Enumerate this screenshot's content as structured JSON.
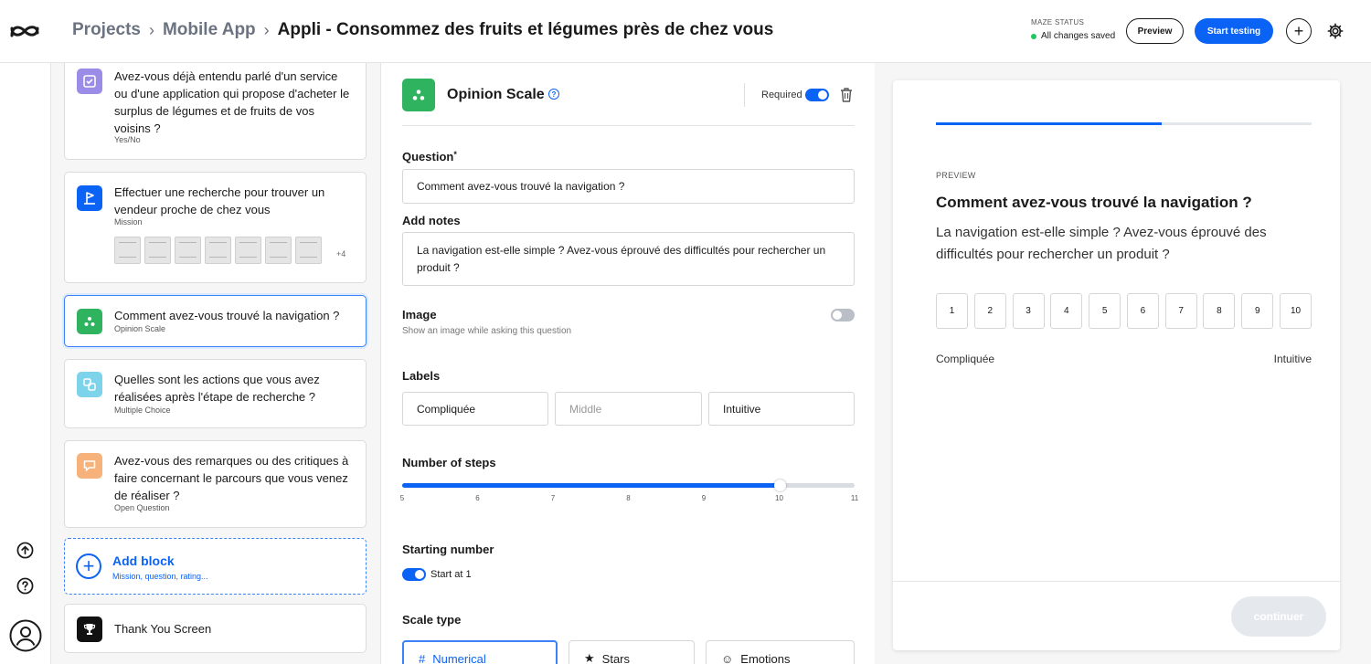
{
  "header": {
    "breadcrumb": [
      "Projects",
      "Mobile App",
      "Appli - Consommez des fruits et légumes près de chez vous"
    ],
    "status_label": "MAZE STATUS",
    "status_value": "All changes saved",
    "preview_label": "Preview",
    "start_label": "Start testing",
    "plus_label": "+"
  },
  "blocks": [
    {
      "title": "Avez-vous déjà entendu parlé d'un service ou d'une application qui propose d'acheter le surplus de légumes et de fruits de vos voisins ?",
      "type": "Yes/No",
      "icon": "yes-no-icon",
      "color": "#9b8ce8"
    },
    {
      "title": "Effectuer une recherche pour trouver un vendeur proche de chez vous",
      "type": "Mission",
      "icon": "mission-flag-icon",
      "color": "#0b63f6",
      "more": "+4"
    },
    {
      "title": "Comment avez-vous trouvé la navigation ?",
      "type": "Opinion Scale",
      "icon": "opinion-scale-icon",
      "color": "#2fb35f"
    },
    {
      "title": "Quelles sont les actions que vous avez réalisées après l'étape de recherche ?",
      "type": "Multiple Choice",
      "icon": "multiple-choice-icon",
      "color": "#7dd3ea"
    },
    {
      "title": "Avez-vous des remarques ou des critiques à faire concernant le parcours que vous venez de réaliser ?",
      "type": "Open Question",
      "icon": "open-question-icon",
      "color": "#f6b27a"
    }
  ],
  "add_block": {
    "title": "Add block",
    "sub": "Mission, question, rating..."
  },
  "thank_you": {
    "title": "Thank You Screen"
  },
  "editor": {
    "title": "Opinion Scale",
    "help": "?",
    "required_label": "Required",
    "question_label": "Question",
    "question_required_mark": "*",
    "question_value": "Comment avez-vous trouvé la navigation ?",
    "notes_label": "Add notes",
    "notes_value": "La navigation est-elle simple ? Avez-vous éprouvé des difficultés pour rechercher un produit ?",
    "image_label": "Image",
    "image_sub": "Show an image while asking this question",
    "labels_label": "Labels",
    "label_left": "Compliquée",
    "label_middle_placeholder": "Middle",
    "label_right": "Intuitive",
    "steps_label": "Number of steps",
    "steps_ticks": [
      "5",
      "6",
      "7",
      "8",
      "9",
      "10",
      "11"
    ],
    "steps_value": 10,
    "steps_min": 5,
    "steps_max": 11,
    "starting_label": "Starting number",
    "starting_value": "Start at 1",
    "scale_type_label": "Scale type",
    "scale_types": [
      "Numerical",
      "Stars",
      "Emotions"
    ]
  },
  "preview": {
    "label": "PREVIEW",
    "progress": 0.6,
    "title": "Comment avez-vous trouvé la navigation ?",
    "notes": "La navigation est-elle simple ? Avez-vous éprouvé des difficultés pour rechercher un produit ?",
    "scale": [
      "1",
      "2",
      "3",
      "4",
      "5",
      "6",
      "7",
      "8",
      "9",
      "10"
    ],
    "left_label": "Compliquée",
    "right_label": "Intuitive",
    "continue_label": "continuer"
  },
  "colors": {
    "accent": "#0b63f6",
    "status": "#22c55e",
    "opinion": "#2fb35f"
  }
}
